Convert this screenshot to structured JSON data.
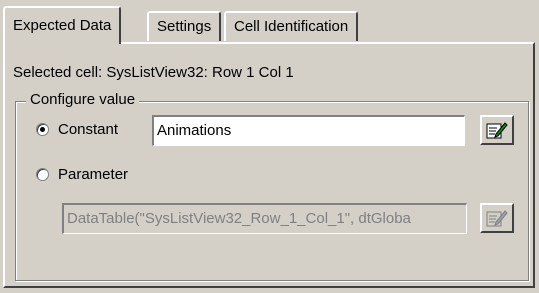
{
  "tabs": [
    {
      "label": "Expected Data",
      "active": true
    },
    {
      "label": "Settings",
      "active": false
    },
    {
      "label": "Cell Identification",
      "active": false
    }
  ],
  "selected_cell_text": "Selected cell: SysListView32: Row 1 Col 1",
  "configure_value": {
    "legend": "Configure value",
    "constant": {
      "label": "Constant",
      "selected": true,
      "value": "Animations",
      "edit_icon": "edit-pencil-icon"
    },
    "parameter": {
      "label": "Parameter",
      "selected": false,
      "value": "DataTable(\"SysListView32_Row_1_Col_1\", dtGloba",
      "disabled": true,
      "edit_icon": "edit-pencil-icon"
    }
  },
  "colors": {
    "dialog_bg": "#d4d0c8",
    "disabled_text": "#808080"
  }
}
